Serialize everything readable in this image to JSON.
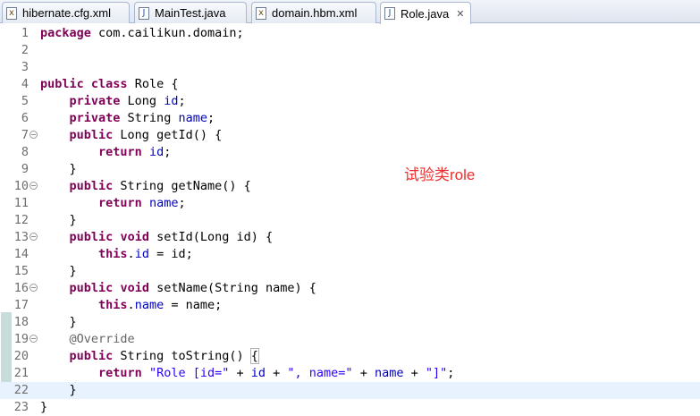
{
  "tabs": [
    {
      "label": "hibernate.cfg.xml",
      "icon": "xml-file-icon",
      "active": false
    },
    {
      "label": "MainTest.java",
      "icon": "java-file-icon",
      "active": false
    },
    {
      "label": "domain.hbm.xml",
      "icon": "xml-file-icon",
      "active": false
    },
    {
      "label": "Role.java",
      "icon": "java-file-icon",
      "active": true,
      "close": "✕"
    }
  ],
  "line_numbers": [
    "1",
    "2",
    "3",
    "4",
    "5",
    "6",
    "7",
    "8",
    "9",
    "10",
    "11",
    "12",
    "13",
    "14",
    "15",
    "16",
    "17",
    "18",
    "19",
    "20",
    "21",
    "22",
    "23"
  ],
  "code": {
    "package_kw": "package",
    "package_name": " com.cailikun.domain;",
    "public": "public",
    "class": "class",
    "private": "private",
    "return": "return",
    "void": "void",
    "this": "this",
    "class_decl": " Role {",
    "long_type": " Long ",
    "string_type": " String ",
    "id": "id",
    "name": "name",
    "semi": ";",
    "getid_sig": " Long getId() {",
    "getname_sig": " String getName() {",
    "setid_sig": " setId(Long id) {",
    "setname_sig": " setName(String name) {",
    "dot": ".",
    "assign_id": " = id;",
    "assign_name": " = name;",
    "override": "@Override",
    "tostring_sig": " String toString() ",
    "open_brace": "{",
    "close_brace": "}",
    "ret_space": " ",
    "str_role": "\"Role [id=\"",
    "plus": " + ",
    "str_name": "\", name=\"",
    "str_end": "\"]\"",
    "end_semi": ";"
  },
  "overlay_text": "试验类role",
  "colors": {
    "keyword": "#7f0055",
    "field": "#0000c0",
    "string": "#2a00ff",
    "annotation": "#646464",
    "overlay": "#ee2e2e",
    "current_line": "#e8f2fe"
  }
}
